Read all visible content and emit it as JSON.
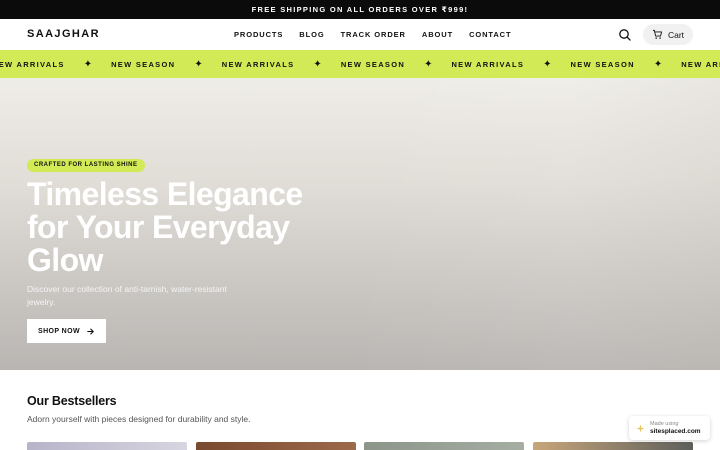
{
  "announcement": "FREE SHIPPING ON ALL ORDERS OVER ₹999!",
  "header": {
    "logo": "SAAJGHAR",
    "nav": [
      "PRODUCTS",
      "BLOG",
      "TRACK ORDER",
      "ABOUT",
      "CONTACT"
    ],
    "cart_label": "Cart"
  },
  "ticker": {
    "items": [
      "NEW ARRIVALS",
      "NEW SEASON",
      "NEW ARRIVALS",
      "NEW SEASON",
      "NEW ARRIVALS",
      "NEW SEASON",
      "NEW ARRIVALS",
      "NEW SEASON"
    ],
    "separator": "✦",
    "bg_color": "#d2ea55"
  },
  "hero": {
    "badge": "CRAFTED FOR LASTING SHINE",
    "title": "Timeless Elegance for Your Everyday Glow",
    "subtitle": "Discover our collection of anti-tarnish, water-resistant jewelry.",
    "cta": "SHOP NOW"
  },
  "bestsellers": {
    "title": "Our Bestsellers",
    "subtitle": "Adorn yourself with pieces designed for durability and style."
  },
  "made_badge": {
    "line1": "Made using",
    "line2": "sitesplaced.com"
  },
  "icons": {
    "search": "search-icon",
    "cart": "cart-icon",
    "arrow": "arrow-right-icon"
  }
}
